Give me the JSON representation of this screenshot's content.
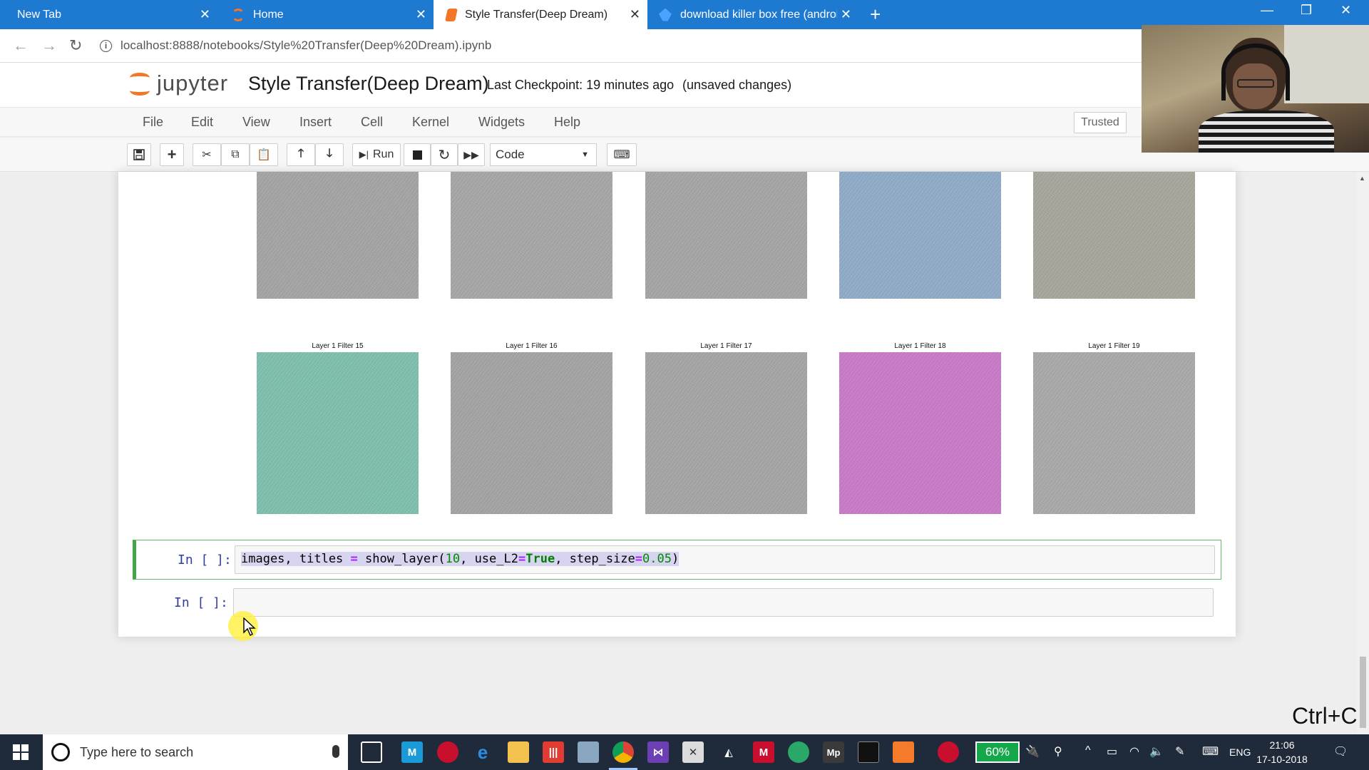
{
  "browser": {
    "tabs": [
      {
        "label": "New Tab"
      },
      {
        "label": "Home"
      },
      {
        "label": "Style Transfer(Deep Dream)"
      },
      {
        "label": "download killer box free (androi"
      }
    ],
    "url": "localhost:8888/notebooks/Style%20Transfer(Deep%20Dream).ipynb"
  },
  "jupyter": {
    "logo_text": "jupyter",
    "notebook_title": "Style Transfer(Deep Dream)",
    "checkpoint": "Last Checkpoint: 19 minutes ago",
    "unsaved": "(unsaved changes)",
    "menu": [
      "File",
      "Edit",
      "View",
      "Insert",
      "Cell",
      "Kernel",
      "Widgets",
      "Help"
    ],
    "trusted_label": "Trusted",
    "toolbar": {
      "run_label": "Run",
      "cell_type": "Code"
    }
  },
  "output": {
    "top_row_colors": [
      "#a4a4a4",
      "#a6a6a6",
      "#a5a5a5",
      "#8fabc8",
      "#a7a69c"
    ],
    "bottom_row": [
      {
        "title": "Layer 1 Filter 15",
        "color": "#7fbfae"
      },
      {
        "title": "Layer 1 Filter 16",
        "color": "#a3a3a3"
      },
      {
        "title": "Layer 1 Filter 17",
        "color": "#a5a5a5"
      },
      {
        "title": "Layer 1 Filter 18",
        "color": "#c97ac8"
      },
      {
        "title": "Layer 1 Filter 19",
        "color": "#a9a9a9"
      }
    ]
  },
  "cells": [
    {
      "prompt": "In [ ]:",
      "code": {
        "a": "images, titles ",
        "eq1": "=",
        "b": " show_layer(",
        "n1": "10",
        "c": ", use_L2",
        "eq2": "=",
        "kw": "True",
        "d": ", step_size",
        "eq3": "=",
        "n2": "0.05",
        "e": ")"
      }
    },
    {
      "prompt": "In [ ]:"
    }
  ],
  "overlay": {
    "shortcut_hint": "Ctrl+C"
  },
  "taskbar": {
    "search_placeholder": "Type here to search",
    "battery": "60%",
    "language": "ENG",
    "time": "21:06",
    "date": "17-10-2018"
  }
}
